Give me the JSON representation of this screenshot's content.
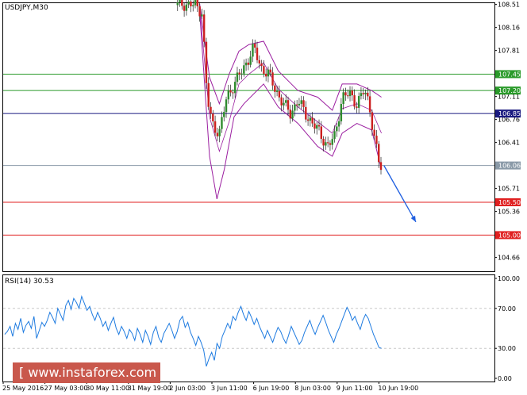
{
  "symbol": "USDJPY,M30",
  "rsi_title": "RSI(14) 30.53",
  "watermark": "[ www.instaforex.com ]",
  "colors": {
    "up": "#2e8b2e",
    "down": "#cc2020",
    "bands": "#9b1fa0",
    "rsi": "#1e7be0",
    "green_level": "#2a9a2a",
    "navy_level": "#1a1a80",
    "gray_level": "#8a9aa8",
    "red_level": "#e02020",
    "arrow": "#1f5fe0",
    "grid": "#c8c8c8"
  },
  "chart_data": [
    {
      "type": "candlestick",
      "title": "USDJPY,M30",
      "y_ticks": [
        104.66,
        105.01,
        105.36,
        105.71,
        106.06,
        106.41,
        106.76,
        107.11,
        107.46,
        107.81,
        108.16,
        108.51
      ],
      "ylim": [
        104.45,
        108.53
      ],
      "x_tick_labels": [
        "25 May 2016",
        "27 May 03:00",
        "30 May 11:00",
        "31 May 19:00",
        "2 Jun 03:00",
        "3 Jun 11:00",
        "6 Jun 19:00",
        "8 Jun 03:00",
        "9 Jun 11:00",
        "10 Jun 19:00"
      ],
      "levels": [
        {
          "value": 107.45,
          "label": "107.45",
          "color": "green"
        },
        {
          "value": 107.2,
          "label": "107.20",
          "color": "green"
        },
        {
          "value": 106.85,
          "label": "106.85",
          "color": "navy"
        },
        {
          "value": 106.06,
          "label": "106.06",
          "color": "gray"
        },
        {
          "value": 105.5,
          "label": "105.50",
          "color": "red"
        },
        {
          "value": 105.0,
          "label": "105.00",
          "color": "red"
        }
      ],
      "price_path": [
        [
          0.355,
          108.5
        ],
        [
          0.36,
          108.52
        ],
        [
          0.39,
          108.5
        ],
        [
          0.405,
          108.4
        ],
        [
          0.415,
          107.1
        ],
        [
          0.425,
          106.7
        ],
        [
          0.44,
          106.55
        ],
        [
          0.455,
          107.1
        ],
        [
          0.47,
          107.3
        ],
        [
          0.49,
          107.55
        ],
        [
          0.51,
          107.85
        ],
        [
          0.525,
          107.55
        ],
        [
          0.54,
          107.45
        ],
        [
          0.555,
          107.2
        ],
        [
          0.57,
          107.0
        ],
        [
          0.585,
          106.85
        ],
        [
          0.6,
          107.05
        ],
        [
          0.615,
          106.85
        ],
        [
          0.63,
          106.7
        ],
        [
          0.645,
          106.55
        ],
        [
          0.66,
          106.35
        ],
        [
          0.675,
          106.5
        ],
        [
          0.69,
          107.1
        ],
        [
          0.705,
          107.15
        ],
        [
          0.72,
          107.0
        ],
        [
          0.735,
          107.2
        ],
        [
          0.745,
          107.0
        ],
        [
          0.755,
          106.5
        ],
        [
          0.765,
          106.1
        ],
        [
          0.77,
          106.0
        ]
      ],
      "bands_upper": [
        [
          0.4,
          108.52
        ],
        [
          0.42,
          107.4
        ],
        [
          0.44,
          107.0
        ],
        [
          0.46,
          107.45
        ],
        [
          0.48,
          107.8
        ],
        [
          0.5,
          107.9
        ],
        [
          0.53,
          107.95
        ],
        [
          0.56,
          107.5
        ],
        [
          0.6,
          107.2
        ],
        [
          0.64,
          107.1
        ],
        [
          0.67,
          106.9
        ],
        [
          0.69,
          107.3
        ],
        [
          0.72,
          107.3
        ],
        [
          0.75,
          107.2
        ],
        [
          0.77,
          107.1
        ]
      ],
      "bands_lower": [
        [
          0.4,
          108.4
        ],
        [
          0.42,
          106.2
        ],
        [
          0.435,
          105.55
        ],
        [
          0.45,
          106.0
        ],
        [
          0.47,
          106.8
        ],
        [
          0.49,
          107.0
        ],
        [
          0.53,
          107.3
        ],
        [
          0.56,
          106.95
        ],
        [
          0.6,
          106.7
        ],
        [
          0.64,
          106.35
        ],
        [
          0.67,
          106.2
        ],
        [
          0.69,
          106.55
        ],
        [
          0.72,
          106.7
        ],
        [
          0.75,
          106.6
        ],
        [
          0.77,
          106.0
        ]
      ],
      "forecast_arrow": {
        "from": [
          0.775,
          106.06
        ],
        "to": [
          0.84,
          105.2
        ]
      }
    },
    {
      "type": "line",
      "title": "RSI(14) 30.53",
      "y_ticks": [
        0.0,
        30.0,
        70.0,
        100.0
      ],
      "ylim": [
        0,
        100
      ],
      "reference_levels": [
        30,
        70
      ],
      "series": [
        {
          "values": [
            44,
            47,
            52,
            42,
            55,
            49,
            60,
            46,
            53,
            57,
            50,
            62,
            40,
            48,
            56,
            52,
            58,
            66,
            61,
            55,
            70,
            64,
            58,
            73,
            78,
            69,
            80,
            76,
            70,
            82,
            75,
            68,
            72,
            64,
            58,
            66,
            60,
            52,
            57,
            48,
            55,
            61,
            50,
            44,
            52,
            47,
            40,
            49,
            45,
            38,
            50,
            44,
            36,
            48,
            42,
            34,
            46,
            52,
            41,
            36,
            45,
            50,
            55,
            48,
            40,
            47,
            58,
            62,
            51,
            56,
            46,
            40,
            33,
            42,
            36,
            28,
            12,
            20,
            26,
            18,
            35,
            30,
            42,
            48,
            55,
            50,
            62,
            58,
            66,
            72,
            64,
            58,
            67,
            61,
            54,
            60,
            52,
            46,
            40,
            48,
            42,
            36,
            44,
            51,
            47,
            40,
            35,
            43,
            52,
            46,
            40,
            34,
            38,
            46,
            52,
            58,
            50,
            44,
            51,
            57,
            63,
            56,
            48,
            42,
            36,
            44,
            50,
            57,
            64,
            71,
            66,
            58,
            62,
            55,
            49,
            58,
            64,
            60,
            52,
            44,
            38,
            31,
            30
          ]
        }
      ]
    }
  ]
}
